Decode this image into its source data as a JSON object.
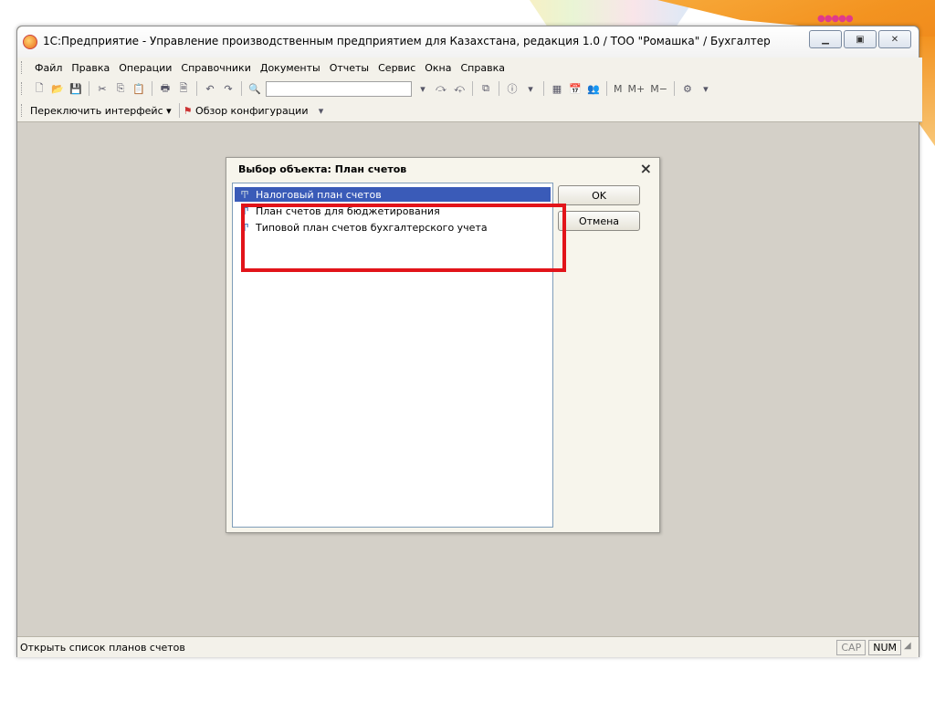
{
  "window": {
    "title": "1С:Предприятие - Управление производственным предприятием для Казахстана, редакция 1.0 / ТОО \"Ромашка\" / Бухгалтер"
  },
  "menubar": {
    "items": [
      "Файл",
      "Правка",
      "Операции",
      "Справочники",
      "Документы",
      "Отчеты",
      "Сервис",
      "Окна",
      "Справка"
    ]
  },
  "toolbar": {
    "memory_labels": [
      "M",
      "M+",
      "M−"
    ]
  },
  "toolbar2": {
    "switch_interface": "Переключить интерфейс",
    "config_overview": "Обзор конфигурации"
  },
  "dialog": {
    "title": "Выбор объекта: План счетов",
    "items": [
      {
        "label": "Налоговый план счетов",
        "selected": true
      },
      {
        "label": "План счетов для бюджетирования",
        "selected": false
      },
      {
        "label": "Типовой план счетов бухгалтерского учета",
        "selected": false
      }
    ],
    "ok_label": "OK",
    "cancel_label": "Отмена"
  },
  "statusbar": {
    "text": "Открыть список планов счетов",
    "indicators": [
      "CAP",
      "NUM"
    ]
  },
  "colors": {
    "selection": "#3a5bb8",
    "highlight_box": "#e2141a",
    "workspace": "#d4d0c8"
  }
}
